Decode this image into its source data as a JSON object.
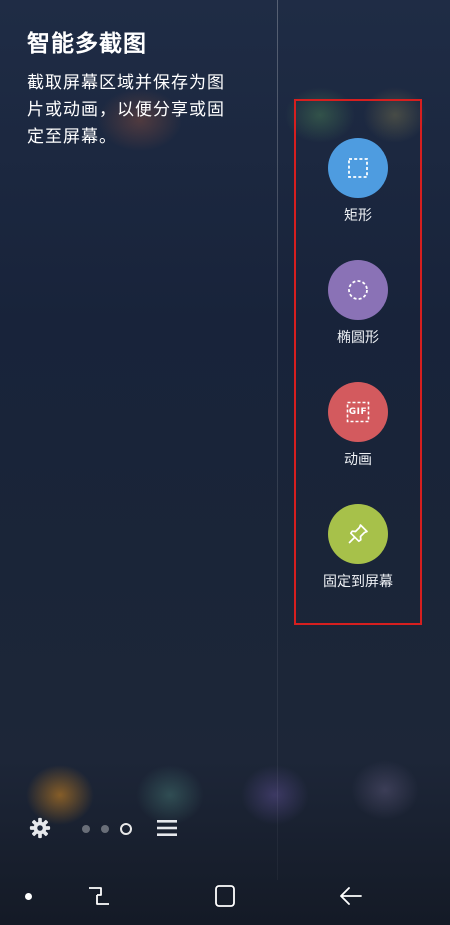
{
  "header": {
    "title": "智能多截图",
    "description": "截取屏幕区域并保存为图片或动画，以便分享或固定至屏幕。"
  },
  "options": [
    {
      "label": "矩形",
      "icon": "rectangle-select-icon",
      "color": "#4e9ce0"
    },
    {
      "label": "椭圆形",
      "icon": "oval-select-icon",
      "color": "#8a72b6"
    },
    {
      "label": "动画",
      "icon": "gif-icon",
      "icon_text": "GIF",
      "color": "#d35a5e"
    },
    {
      "label": "固定到屏幕",
      "icon": "pin-icon",
      "color": "#a7c14a"
    }
  ],
  "highlight_color": "#d61f1f",
  "edge_bar": {
    "settings_icon": "gear-icon",
    "page_indicator": {
      "count": 3,
      "active": 3
    },
    "menu_icon": "menu-icon"
  },
  "navigation": {
    "icons": [
      "dot-icon",
      "recents-icon",
      "home-icon",
      "back-icon"
    ]
  }
}
